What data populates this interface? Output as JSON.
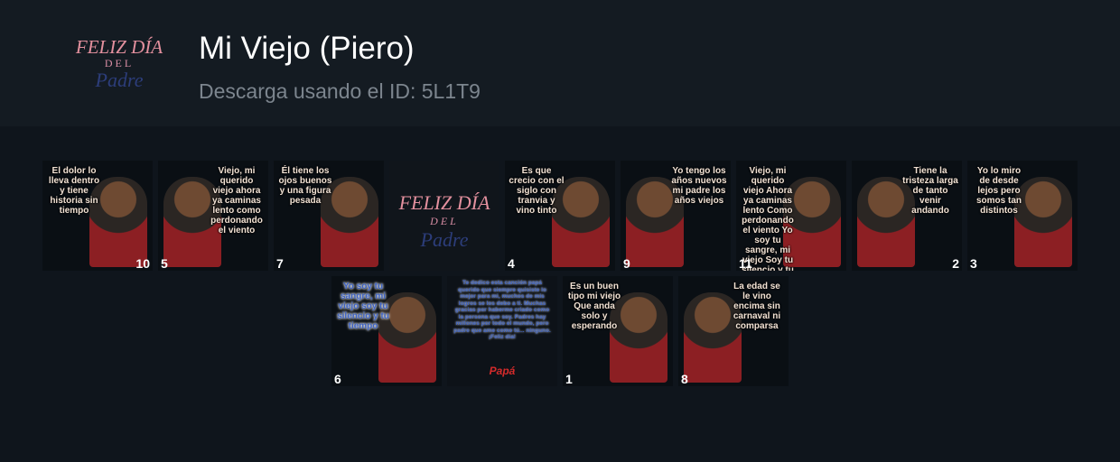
{
  "pack": {
    "title": "Mi Viejo (Piero)",
    "subtitle": "Descarga usando el ID: 5L1T9",
    "icon": {
      "line1": "FELIZ DÍA",
      "line2": "DEL",
      "line3": "Padre"
    }
  },
  "stickers_row1": [
    {
      "quote": "El dolor lo lleva dentro y tiene historia sin tiempo",
      "emoji": "10",
      "emoji_pos": "after"
    },
    {
      "quote": "Viejo, mi querido viejo ahora ya caminas lento como perdonando el viento",
      "emoji": "5"
    },
    {
      "quote": "Él tiene los ojos buenos y una figura pesada",
      "emoji": "7"
    },
    {
      "feliz": {
        "line1": "FELIZ DÍA",
        "line2": "DEL",
        "line3": "Padre"
      }
    },
    {
      "quote": "Es que crecio con el siglo con tranvia y vino tinto",
      "emoji": "4"
    },
    {
      "quote": "Yo tengo los años nuevos mi padre los años viejos",
      "emoji": "9"
    },
    {
      "quote": "Viejo, mi querido viejo Ahora ya caminas lento Como perdonando el viento Yo soy tu sangre, mi viejo Soy tu silencio y tu tiempo",
      "emoji": "11"
    },
    {
      "quote": "Tiene la tristeza larga de tanto venir andando",
      "emoji": "2",
      "emoji_pos": "after"
    },
    {
      "quote": "Yo lo miro de desde lejos pero somos tan distintos",
      "emoji": "3"
    }
  ],
  "stickers_row2": [
    {
      "quote": "Yo soy tu sangre, mi viejo soy tu silencio y tu tiempo",
      "emoji": "6"
    },
    {
      "card": "Te dedico esta canción papá querido que siempre quisiste lo mejor para mi, muchos de mis logros se los debo a ti. Muchas gracias por haberme criado como la persona que soy. Padres hay millones por todo el mundo, pero padre que ame como tú... ninguno. ¡Feliz día!",
      "signature": "Papá"
    },
    {
      "quote": "Es un buen tipo mi viejo Que anda solo y esperando",
      "emoji": "1"
    },
    {
      "quote": "La edad se le vino encima sin carnaval ni comparsa",
      "emoji": "8"
    }
  ]
}
